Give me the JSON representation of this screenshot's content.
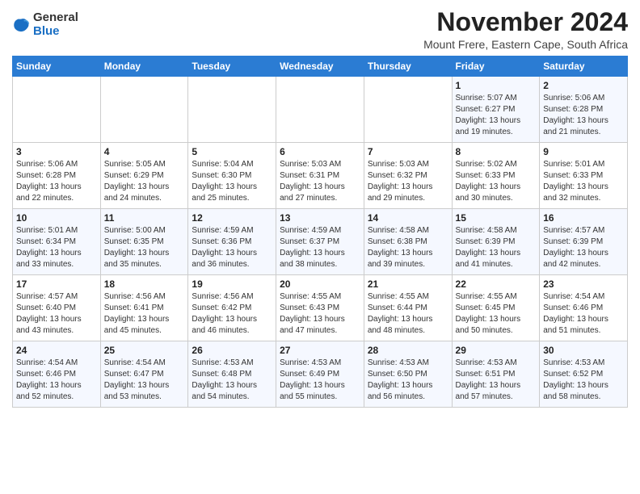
{
  "header": {
    "logo_general": "General",
    "logo_blue": "Blue",
    "month_title": "November 2024",
    "location": "Mount Frere, Eastern Cape, South Africa"
  },
  "weekdays": [
    "Sunday",
    "Monday",
    "Tuesday",
    "Wednesday",
    "Thursday",
    "Friday",
    "Saturday"
  ],
  "weeks": [
    [
      {
        "day": "",
        "info": ""
      },
      {
        "day": "",
        "info": ""
      },
      {
        "day": "",
        "info": ""
      },
      {
        "day": "",
        "info": ""
      },
      {
        "day": "",
        "info": ""
      },
      {
        "day": "1",
        "info": "Sunrise: 5:07 AM\nSunset: 6:27 PM\nDaylight: 13 hours and 19 minutes."
      },
      {
        "day": "2",
        "info": "Sunrise: 5:06 AM\nSunset: 6:28 PM\nDaylight: 13 hours and 21 minutes."
      }
    ],
    [
      {
        "day": "3",
        "info": "Sunrise: 5:06 AM\nSunset: 6:28 PM\nDaylight: 13 hours and 22 minutes."
      },
      {
        "day": "4",
        "info": "Sunrise: 5:05 AM\nSunset: 6:29 PM\nDaylight: 13 hours and 24 minutes."
      },
      {
        "day": "5",
        "info": "Sunrise: 5:04 AM\nSunset: 6:30 PM\nDaylight: 13 hours and 25 minutes."
      },
      {
        "day": "6",
        "info": "Sunrise: 5:03 AM\nSunset: 6:31 PM\nDaylight: 13 hours and 27 minutes."
      },
      {
        "day": "7",
        "info": "Sunrise: 5:03 AM\nSunset: 6:32 PM\nDaylight: 13 hours and 29 minutes."
      },
      {
        "day": "8",
        "info": "Sunrise: 5:02 AM\nSunset: 6:33 PM\nDaylight: 13 hours and 30 minutes."
      },
      {
        "day": "9",
        "info": "Sunrise: 5:01 AM\nSunset: 6:33 PM\nDaylight: 13 hours and 32 minutes."
      }
    ],
    [
      {
        "day": "10",
        "info": "Sunrise: 5:01 AM\nSunset: 6:34 PM\nDaylight: 13 hours and 33 minutes."
      },
      {
        "day": "11",
        "info": "Sunrise: 5:00 AM\nSunset: 6:35 PM\nDaylight: 13 hours and 35 minutes."
      },
      {
        "day": "12",
        "info": "Sunrise: 4:59 AM\nSunset: 6:36 PM\nDaylight: 13 hours and 36 minutes."
      },
      {
        "day": "13",
        "info": "Sunrise: 4:59 AM\nSunset: 6:37 PM\nDaylight: 13 hours and 38 minutes."
      },
      {
        "day": "14",
        "info": "Sunrise: 4:58 AM\nSunset: 6:38 PM\nDaylight: 13 hours and 39 minutes."
      },
      {
        "day": "15",
        "info": "Sunrise: 4:58 AM\nSunset: 6:39 PM\nDaylight: 13 hours and 41 minutes."
      },
      {
        "day": "16",
        "info": "Sunrise: 4:57 AM\nSunset: 6:39 PM\nDaylight: 13 hours and 42 minutes."
      }
    ],
    [
      {
        "day": "17",
        "info": "Sunrise: 4:57 AM\nSunset: 6:40 PM\nDaylight: 13 hours and 43 minutes."
      },
      {
        "day": "18",
        "info": "Sunrise: 4:56 AM\nSunset: 6:41 PM\nDaylight: 13 hours and 45 minutes."
      },
      {
        "day": "19",
        "info": "Sunrise: 4:56 AM\nSunset: 6:42 PM\nDaylight: 13 hours and 46 minutes."
      },
      {
        "day": "20",
        "info": "Sunrise: 4:55 AM\nSunset: 6:43 PM\nDaylight: 13 hours and 47 minutes."
      },
      {
        "day": "21",
        "info": "Sunrise: 4:55 AM\nSunset: 6:44 PM\nDaylight: 13 hours and 48 minutes."
      },
      {
        "day": "22",
        "info": "Sunrise: 4:55 AM\nSunset: 6:45 PM\nDaylight: 13 hours and 50 minutes."
      },
      {
        "day": "23",
        "info": "Sunrise: 4:54 AM\nSunset: 6:46 PM\nDaylight: 13 hours and 51 minutes."
      }
    ],
    [
      {
        "day": "24",
        "info": "Sunrise: 4:54 AM\nSunset: 6:46 PM\nDaylight: 13 hours and 52 minutes."
      },
      {
        "day": "25",
        "info": "Sunrise: 4:54 AM\nSunset: 6:47 PM\nDaylight: 13 hours and 53 minutes."
      },
      {
        "day": "26",
        "info": "Sunrise: 4:53 AM\nSunset: 6:48 PM\nDaylight: 13 hours and 54 minutes."
      },
      {
        "day": "27",
        "info": "Sunrise: 4:53 AM\nSunset: 6:49 PM\nDaylight: 13 hours and 55 minutes."
      },
      {
        "day": "28",
        "info": "Sunrise: 4:53 AM\nSunset: 6:50 PM\nDaylight: 13 hours and 56 minutes."
      },
      {
        "day": "29",
        "info": "Sunrise: 4:53 AM\nSunset: 6:51 PM\nDaylight: 13 hours and 57 minutes."
      },
      {
        "day": "30",
        "info": "Sunrise: 4:53 AM\nSunset: 6:52 PM\nDaylight: 13 hours and 58 minutes."
      }
    ]
  ]
}
